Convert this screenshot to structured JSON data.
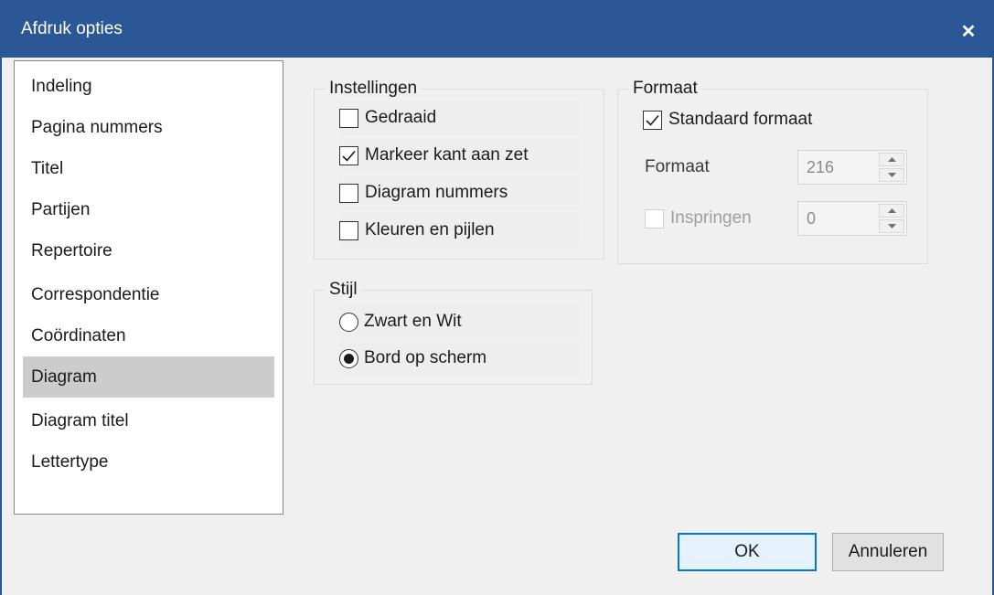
{
  "window": {
    "title": "Afdruk opties",
    "close_glyph": "✕"
  },
  "sidebar": {
    "items": [
      {
        "label": "Indeling"
      },
      {
        "label": "Pagina nummers"
      },
      {
        "label": "Titel"
      },
      {
        "label": "Partijen"
      },
      {
        "label": "Repertoire"
      },
      {
        "label": "Correspondentie"
      },
      {
        "label": "Coördinaten"
      },
      {
        "label": "Diagram",
        "selected": true
      },
      {
        "label": "Diagram titel"
      },
      {
        "label": "Lettertype"
      }
    ]
  },
  "instellingen": {
    "label": "Instellingen",
    "options": [
      {
        "label": "Gedraaid",
        "checked": false
      },
      {
        "label": "Markeer kant aan zet",
        "checked": true
      },
      {
        "label": "Diagram nummers",
        "checked": false
      },
      {
        "label": "Kleuren en pijlen",
        "checked": false
      }
    ]
  },
  "formaat": {
    "label": "Formaat",
    "standard_label": "Standaard formaat",
    "standard_checked": true,
    "size_label": "Formaat",
    "size_value": "216",
    "indent_label": "Inspringen",
    "indent_checked": false,
    "indent_value": "0"
  },
  "stijl": {
    "label": "Stijl",
    "options": [
      {
        "label": "Zwart en Wit",
        "selected": false
      },
      {
        "label": "Bord op scherm",
        "selected": true
      }
    ]
  },
  "buttons": {
    "ok": "OK",
    "cancel": "Annuleren"
  }
}
